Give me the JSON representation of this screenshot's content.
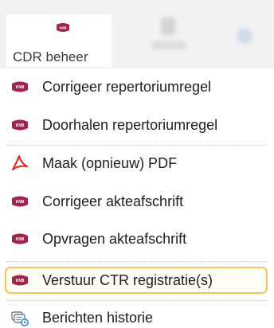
{
  "ribbon": {
    "button_label": "CDR beheer",
    "button_icon": "knb-logo-icon"
  },
  "menu": {
    "items": [
      {
        "label": "Corrigeer repertoriumregel",
        "icon": "knb-logo-icon"
      },
      {
        "label": "Doorhalen repertoriumregel",
        "icon": "knb-logo-icon"
      },
      {
        "label": "Maak (opnieuw) PDF",
        "icon": "pdf-icon"
      },
      {
        "label": "Corrigeer akteafschrift",
        "icon": "knb-logo-icon"
      },
      {
        "label": "Opvragen akteafschrift",
        "icon": "knb-logo-icon"
      },
      {
        "label": "Verstuur CTR registratie(s)",
        "icon": "knb-logo-icon",
        "highlighted": true
      },
      {
        "label": "Berichten historie",
        "icon": "message-history-icon"
      }
    ]
  },
  "colors": {
    "knb_brand": "#a3244a",
    "pdf_red": "#e2231a",
    "highlight_border": "#f3c45a"
  }
}
